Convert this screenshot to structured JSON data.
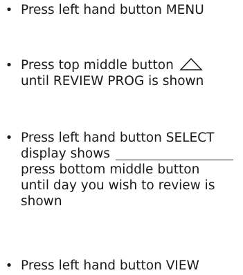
{
  "steps": [
    {
      "line1": "Press left hand button MENU"
    },
    {
      "line1": "Press top middle button",
      "icon": "triangle-up-icon",
      "line2": "until REVIEW PROG is shown"
    },
    {
      "line1": "Press left hand button SELECT",
      "line2": "display shows",
      "line3": "press bottom middle button",
      "line4": "until day you wish to review is",
      "line5": "shown"
    },
    {
      "line1": "Press left hand button VIEW"
    }
  ]
}
